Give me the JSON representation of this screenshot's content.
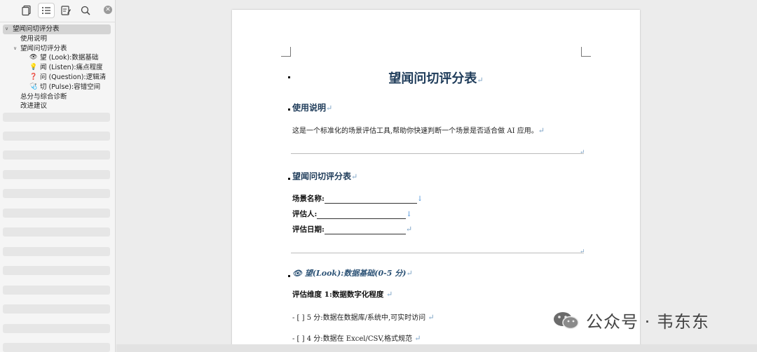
{
  "sidebar": {
    "outline": [
      {
        "label": "望闻问切评分表",
        "caret": "∨",
        "icon": ""
      },
      {
        "label": "使用说明",
        "caret": "",
        "icon": ""
      },
      {
        "label": "望闻问切评分表",
        "caret": "∨",
        "icon": ""
      },
      {
        "label": "望 (Look):数据基础",
        "caret": "",
        "icon": "👁"
      },
      {
        "label": "闻 (Listen):痛点程度",
        "caret": "",
        "icon": "💡"
      },
      {
        "label": "问 (Question):逻辑清",
        "caret": "",
        "icon": "❓"
      },
      {
        "label": "切 (Pulse):容错空间",
        "caret": "",
        "icon": "🩺"
      },
      {
        "label": "总分与综合诊断",
        "caret": "",
        "icon": ""
      },
      {
        "label": "改进建议",
        "caret": "",
        "icon": ""
      }
    ]
  },
  "doc": {
    "paragraph_mark": "↵",
    "line_break_mark": "↓",
    "title": "望闻问切评分表",
    "section1": {
      "heading": "使用说明",
      "body": "这是一个标准化的场景评估工具,帮助你快速判断一个场景是否适合做 AI 应用。"
    },
    "section2": {
      "heading": "望闻问切评分表",
      "fields": [
        "场景名称:",
        "评估人:",
        "评估日期:"
      ]
    },
    "section3": {
      "icon": "👁",
      "heading": "望(Look):数据基础(0-5 分)",
      "dimension": "评估维度 1:数据数字化程度",
      "options": [
        "- [ ] 5 分:数据在数据库/系统中,可实时访问",
        "- [ ] 4 分:数据在 Excel/CSV,格式规范"
      ]
    }
  },
  "watermark": {
    "text": "公众号 · 韦东东"
  }
}
